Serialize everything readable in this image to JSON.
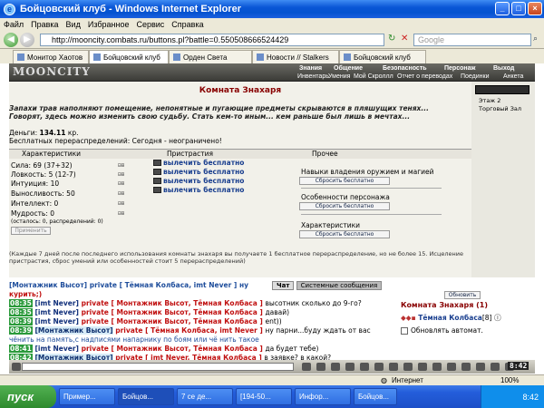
{
  "window": {
    "title": "Бойцовский клуб - Windows Internet Explorer"
  },
  "menu": [
    "Файл",
    "Правка",
    "Вид",
    "Избранное",
    "Сервис",
    "Справка"
  ],
  "address": {
    "url": "http://mooncity.combats.ru/buttons.pl?battle=0.550508666524429",
    "search_placeholder": "Google"
  },
  "tabs": [
    "Монитор Хаотов",
    "Бойцовский клуб",
    "Орден Света",
    "Новости // Stalkers",
    "Бойцовский клуб"
  ],
  "game": {
    "logo": "MOONCITY",
    "menu_top": [
      "Знания",
      "Общение",
      "Безопасность",
      "Персонаж",
      "Выход"
    ],
    "menu_bottom": [
      "Инвентарь",
      "Умения",
      "Мой Скроллл",
      "Отчет о переводах",
      "Поединки",
      "Анкета"
    ],
    "side": [
      "Этаж 2",
      "Торговый Зал"
    ]
  },
  "room": {
    "title": "Комната Знахаря",
    "intro1": "Запахи трав наполняют помещение, непонятные и пугающие предметы скрываются в пляшущих тенях...",
    "intro2": "Говорят, здесь можно изменить свою судьбу. Стать кем-то иным... кем раньше был лишь в мечтах...",
    "money_label": "Деньги:",
    "money_value": "134.11",
    "money_unit": "кр.",
    "free": "Бесплатных перераспределений: Сегодня - неограничено!",
    "col1": "Характеристики",
    "col2": "Пристрастия",
    "col3": "Прочее",
    "stats": [
      "Сила: 69 (37+32)",
      "Ловкость: 5 (12-7)",
      "Интуиция: 10",
      "Выносливость: 50",
      "Интеллект: 0",
      "Мудрость: 0"
    ],
    "stats_note": "(осталось: 0, распределений: 0)",
    "apply": "Применить",
    "injuries": [
      "вылечить бесплатно",
      "вылечить бесплатно",
      "вылечить бесплатно",
      "вылечить бесплатно"
    ],
    "other": [
      {
        "label": "Навыки владения оружием и магией",
        "btn": "Сбросить бесплатно"
      },
      {
        "label": "Особенности персонажа",
        "btn": "Сбросить бесплатно"
      },
      {
        "label": "Характеристики",
        "btn": "Сбросить бесплатно"
      }
    ],
    "footnote": "(Каждые 7 дней после последнего использования комнаты знахаря вы получаете 1 бесплатное перераспределение, но не более 15. Исцеление пристрастия, сброс умений или особенностей стоит 5 перераспределений)"
  },
  "chat": {
    "tabs": [
      "Чат",
      "Системные сообщения"
    ],
    "lines": [
      {
        "time": "",
        "text": "[Монтажник Высот] private [ Тёмная Колбаса, imt Never ] ну"
      },
      {
        "time": "",
        "text": "курить;)"
      },
      {
        "time": "08:35",
        "name": "[imt Never]",
        "priv": "private [ Монтажник Высот, Тёмная Колбаса ]",
        "msg": "высотник сколько до 9-го?"
      },
      {
        "time": "08:35",
        "name": "[imt Never]",
        "priv": "private [ Монтажник Высот, Тёмная Колбаса ]",
        "msg": "давай)"
      },
      {
        "time": "08:39",
        "name": "[imt Never]",
        "priv": "private [ Монтажник Высот, Тёмная Колбаса ]",
        "msg": "ent))"
      },
      {
        "time": "08:39",
        "name": "[Монтажник Высот]",
        "priv": "private [ Тёмная Колбаса, imt Never ]",
        "msg": "ну парни...буду ждать от вас"
      },
      {
        "time": "",
        "text": "чёнить на память,с надписями напарнику по боям или чё нить такое"
      },
      {
        "time": "08:41",
        "name": "[imt Never]",
        "priv": "private [ Монтажник Высот, Тёмная Колбаса ]",
        "msg": "да будет тебе)"
      },
      {
        "time": "08:42",
        "name": "[Монтажник Высот]",
        "priv": "private [ imt Never, Тёмная Колбаса ]",
        "msg": "в заявке? в какой?"
      }
    ]
  },
  "right": {
    "refresh": "Обновить",
    "room": "Комната Знахаря (1)",
    "user": "Тёмная Колбаса",
    "level": "[8]",
    "auto": "Обновлять автомат."
  },
  "status": {
    "zone": "Интернет",
    "zoom": "100%"
  },
  "taskbar": {
    "start": "пуск",
    "items": [
      "Пример...",
      "Бойцов...",
      "7 се де...",
      "[194-50...",
      "Инфор...",
      "Бойцов..."
    ],
    "clock": "8:42"
  }
}
